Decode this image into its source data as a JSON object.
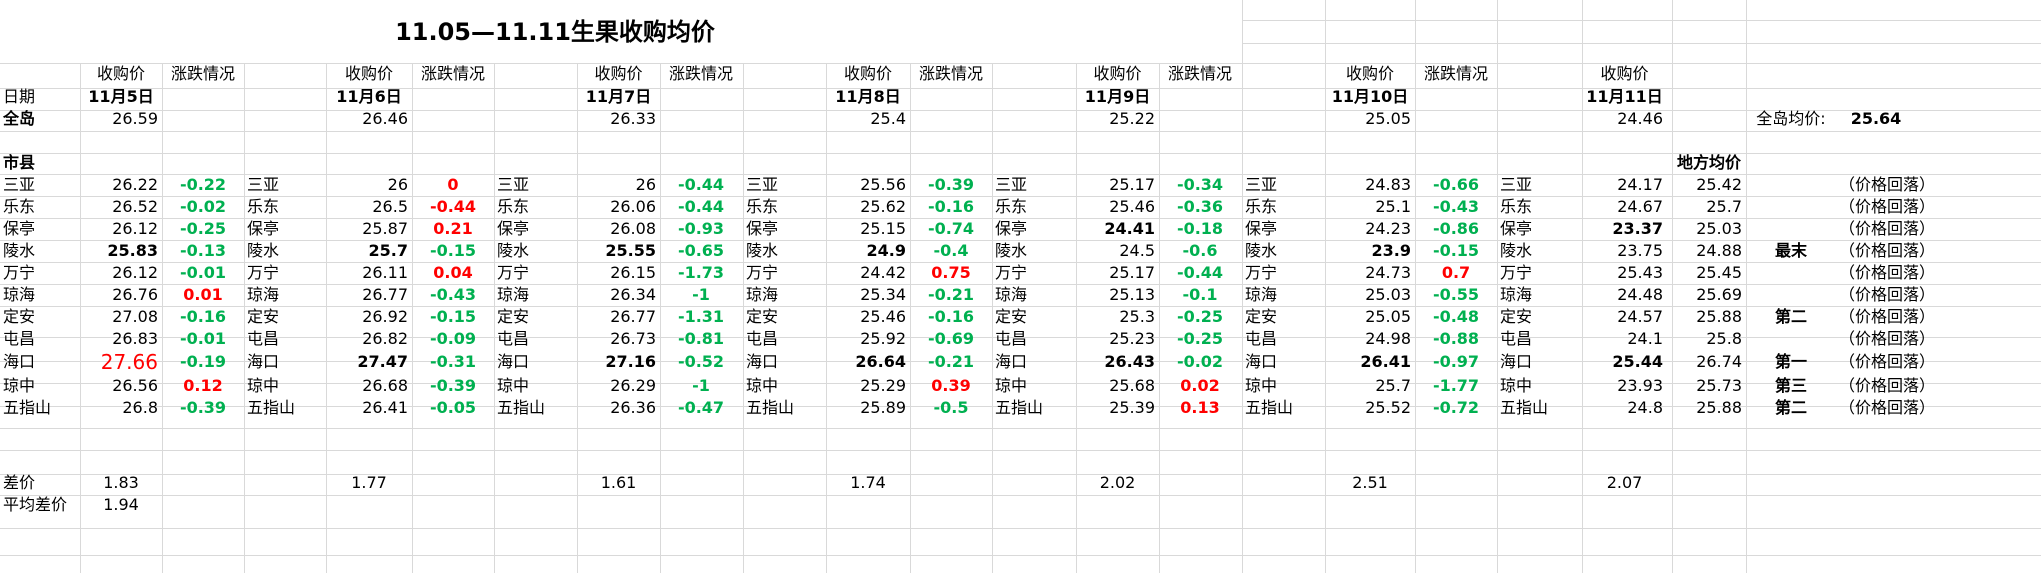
{
  "title": "11.05—11.11生果收购均价",
  "headers": {
    "price": "收购价",
    "change": "涨跌情况",
    "date": "日期",
    "island": "全岛",
    "county": "市县",
    "local_avg": "地方均价",
    "island_avg_label": "全岛均价:"
  },
  "island_avg_value": "25.64",
  "diff_label": "差价",
  "avg_diff_label": "平均差价",
  "avg_diff_value": "1.94",
  "blocks": [
    {
      "date": "11月5日",
      "island": "26.59",
      "diff": "1.83",
      "rows": [
        {
          "name": "三亚",
          "price": "26.22",
          "change": "-0.22",
          "color": "#00b050"
        },
        {
          "name": "乐东",
          "price": "26.52",
          "change": "-0.02",
          "color": "#00b050"
        },
        {
          "name": "保亭",
          "price": "26.12",
          "change": "-0.25",
          "color": "#00b050"
        },
        {
          "name": "陵水",
          "price": "25.83",
          "change": "-0.13",
          "color": "#00b050",
          "bold": true
        },
        {
          "name": "万宁",
          "price": "26.12",
          "change": "-0.01",
          "color": "#00b050"
        },
        {
          "name": "琼海",
          "price": "26.76",
          "change": "0.01",
          "color": "#ff0000"
        },
        {
          "name": "定安",
          "price": "27.08",
          "change": "-0.16",
          "color": "#00b050"
        },
        {
          "name": "屯昌",
          "price": "26.83",
          "change": "-0.01",
          "color": "#00b050"
        },
        {
          "name": "海口",
          "price": "27.66",
          "change": "-0.19",
          "color": "#00b050",
          "highlight": true
        },
        {
          "name": "琼中",
          "price": "26.56",
          "change": "0.12",
          "color": "#ff0000"
        },
        {
          "name": "五指山",
          "price": "26.8",
          "change": "-0.39",
          "color": "#00b050"
        }
      ]
    },
    {
      "date": "11月6日",
      "island": "26.46",
      "diff": "1.77",
      "rows": [
        {
          "name": "三亚",
          "price": "26",
          "change": "0",
          "color": "#ff0000"
        },
        {
          "name": "乐东",
          "price": "26.5",
          "change": "-0.44",
          "color": "#ff0000"
        },
        {
          "name": "保亭",
          "price": "25.87",
          "change": "0.21",
          "color": "#ff0000"
        },
        {
          "name": "陵水",
          "price": "25.7",
          "change": "-0.15",
          "color": "#00b050",
          "bold": true
        },
        {
          "name": "万宁",
          "price": "26.11",
          "change": "0.04",
          "color": "#ff0000"
        },
        {
          "name": "琼海",
          "price": "26.77",
          "change": "-0.43",
          "color": "#00b050"
        },
        {
          "name": "定安",
          "price": "26.92",
          "change": "-0.15",
          "color": "#00b050"
        },
        {
          "name": "屯昌",
          "price": "26.82",
          "change": "-0.09",
          "color": "#00b050"
        },
        {
          "name": "海口",
          "price": "27.47",
          "change": "-0.31",
          "color": "#00b050",
          "bold": true
        },
        {
          "name": "琼中",
          "price": "26.68",
          "change": "-0.39",
          "color": "#00b050"
        },
        {
          "name": "五指山",
          "price": "26.41",
          "change": "-0.05",
          "color": "#00b050"
        }
      ]
    },
    {
      "date": "11月7日",
      "island": "26.33",
      "diff": "1.61",
      "rows": [
        {
          "name": "三亚",
          "price": "26",
          "change": "-0.44",
          "color": "#00b050"
        },
        {
          "name": "乐东",
          "price": "26.06",
          "change": "-0.44",
          "color": "#00b050"
        },
        {
          "name": "保亭",
          "price": "26.08",
          "change": "-0.93",
          "color": "#00b050"
        },
        {
          "name": "陵水",
          "price": "25.55",
          "change": "-0.65",
          "color": "#00b050",
          "bold": true
        },
        {
          "name": "万宁",
          "price": "26.15",
          "change": "-1.73",
          "color": "#00b050"
        },
        {
          "name": "琼海",
          "price": "26.34",
          "change": "-1",
          "color": "#00b050"
        },
        {
          "name": "定安",
          "price": "26.77",
          "change": "-1.31",
          "color": "#00b050"
        },
        {
          "name": "屯昌",
          "price": "26.73",
          "change": "-0.81",
          "color": "#00b050"
        },
        {
          "name": "海口",
          "price": "27.16",
          "change": "-0.52",
          "color": "#00b050",
          "bold": true
        },
        {
          "name": "琼中",
          "price": "26.29",
          "change": "-1",
          "color": "#00b050"
        },
        {
          "name": "五指山",
          "price": "26.36",
          "change": "-0.47",
          "color": "#00b050"
        }
      ]
    },
    {
      "date": "11月8日",
      "island": "25.4",
      "diff": "1.74",
      "rows": [
        {
          "name": "三亚",
          "price": "25.56",
          "change": "-0.39",
          "color": "#00b050"
        },
        {
          "name": "乐东",
          "price": "25.62",
          "change": "-0.16",
          "color": "#00b050"
        },
        {
          "name": "保亭",
          "price": "25.15",
          "change": "-0.74",
          "color": "#00b050"
        },
        {
          "name": "陵水",
          "price": "24.9",
          "change": "-0.4",
          "color": "#00b050",
          "bold": true
        },
        {
          "name": "万宁",
          "price": "24.42",
          "change": "0.75",
          "color": "#ff0000"
        },
        {
          "name": "琼海",
          "price": "25.34",
          "change": "-0.21",
          "color": "#00b050"
        },
        {
          "name": "定安",
          "price": "25.46",
          "change": "-0.16",
          "color": "#00b050"
        },
        {
          "name": "屯昌",
          "price": "25.92",
          "change": "-0.69",
          "color": "#00b050"
        },
        {
          "name": "海口",
          "price": "26.64",
          "change": "-0.21",
          "color": "#00b050",
          "bold": true
        },
        {
          "name": "琼中",
          "price": "25.29",
          "change": "0.39",
          "color": "#ff0000"
        },
        {
          "name": "五指山",
          "price": "25.89",
          "change": "-0.5",
          "color": "#00b050"
        }
      ]
    },
    {
      "date": "11月9日",
      "island": "25.22",
      "diff": "2.02",
      "rows": [
        {
          "name": "三亚",
          "price": "25.17",
          "change": "-0.34",
          "color": "#00b050"
        },
        {
          "name": "乐东",
          "price": "25.46",
          "change": "-0.36",
          "color": "#00b050"
        },
        {
          "name": "保亭",
          "price": "24.41",
          "change": "-0.18",
          "color": "#00b050",
          "bold": true
        },
        {
          "name": "陵水",
          "price": "24.5",
          "change": "-0.6",
          "color": "#00b050"
        },
        {
          "name": "万宁",
          "price": "25.17",
          "change": "-0.44",
          "color": "#00b050"
        },
        {
          "name": "琼海",
          "price": "25.13",
          "change": "-0.1",
          "color": "#00b050"
        },
        {
          "name": "定安",
          "price": "25.3",
          "change": "-0.25",
          "color": "#00b050"
        },
        {
          "name": "屯昌",
          "price": "25.23",
          "change": "-0.25",
          "color": "#00b050"
        },
        {
          "name": "海口",
          "price": "26.43",
          "change": "-0.02",
          "color": "#00b050",
          "bold": true
        },
        {
          "name": "琼中",
          "price": "25.68",
          "change": "0.02",
          "color": "#ff0000"
        },
        {
          "name": "五指山",
          "price": "25.39",
          "change": "0.13",
          "color": "#ff0000"
        }
      ]
    },
    {
      "date": "11月10日",
      "island": "25.05",
      "diff": "2.51",
      "rows": [
        {
          "name": "三亚",
          "price": "24.83",
          "change": "-0.66",
          "color": "#00b050"
        },
        {
          "name": "乐东",
          "price": "25.1",
          "change": "-0.43",
          "color": "#00b050"
        },
        {
          "name": "保亭",
          "price": "24.23",
          "change": "-0.86",
          "color": "#00b050"
        },
        {
          "name": "陵水",
          "price": "23.9",
          "change": "-0.15",
          "color": "#00b050",
          "bold": true
        },
        {
          "name": "万宁",
          "price": "24.73",
          "change": "0.7",
          "color": "#ff0000"
        },
        {
          "name": "琼海",
          "price": "25.03",
          "change": "-0.55",
          "color": "#00b050"
        },
        {
          "name": "定安",
          "price": "25.05",
          "change": "-0.48",
          "color": "#00b050"
        },
        {
          "name": "屯昌",
          "price": "24.98",
          "change": "-0.88",
          "color": "#00b050"
        },
        {
          "name": "海口",
          "price": "26.41",
          "change": "-0.97",
          "color": "#00b050",
          "bold": true
        },
        {
          "name": "琼中",
          "price": "25.7",
          "change": "-1.77",
          "color": "#00b050"
        },
        {
          "name": "五指山",
          "price": "25.52",
          "change": "-0.72",
          "color": "#00b050"
        }
      ]
    },
    {
      "date": "11月11日",
      "island": "24.46",
      "diff": "2.07",
      "rows": [
        {
          "name": "三亚",
          "price": "24.17"
        },
        {
          "name": "乐东",
          "price": "24.67"
        },
        {
          "name": "保亭",
          "price": "23.37",
          "bold": true
        },
        {
          "name": "陵水",
          "price": "23.75"
        },
        {
          "name": "万宁",
          "price": "25.43"
        },
        {
          "name": "琼海",
          "price": "24.48"
        },
        {
          "name": "定安",
          "price": "24.57"
        },
        {
          "name": "屯昌",
          "price": "24.1"
        },
        {
          "name": "海口",
          "price": "25.44",
          "bold": true
        },
        {
          "name": "琼中",
          "price": "23.93"
        },
        {
          "name": "五指山",
          "price": "24.8"
        }
      ]
    }
  ],
  "local_avgs": [
    "25.42",
    "25.7",
    "25.03",
    "24.88",
    "25.45",
    "25.69",
    "25.88",
    "25.8",
    "26.74",
    "25.73",
    "25.88"
  ],
  "ranks": [
    "",
    "",
    "",
    "最末",
    "",
    "",
    "第二",
    "",
    "第一",
    "第三",
    "第二"
  ],
  "notes": [
    "（价格回落）",
    "（价格回落）",
    "（价格回落）",
    "（价格回落）",
    "（价格回落）",
    "（价格回落）",
    "（价格回落）",
    "（价格回落）",
    "（价格回落）",
    "（价格回落）",
    "（价格回落）"
  ]
}
